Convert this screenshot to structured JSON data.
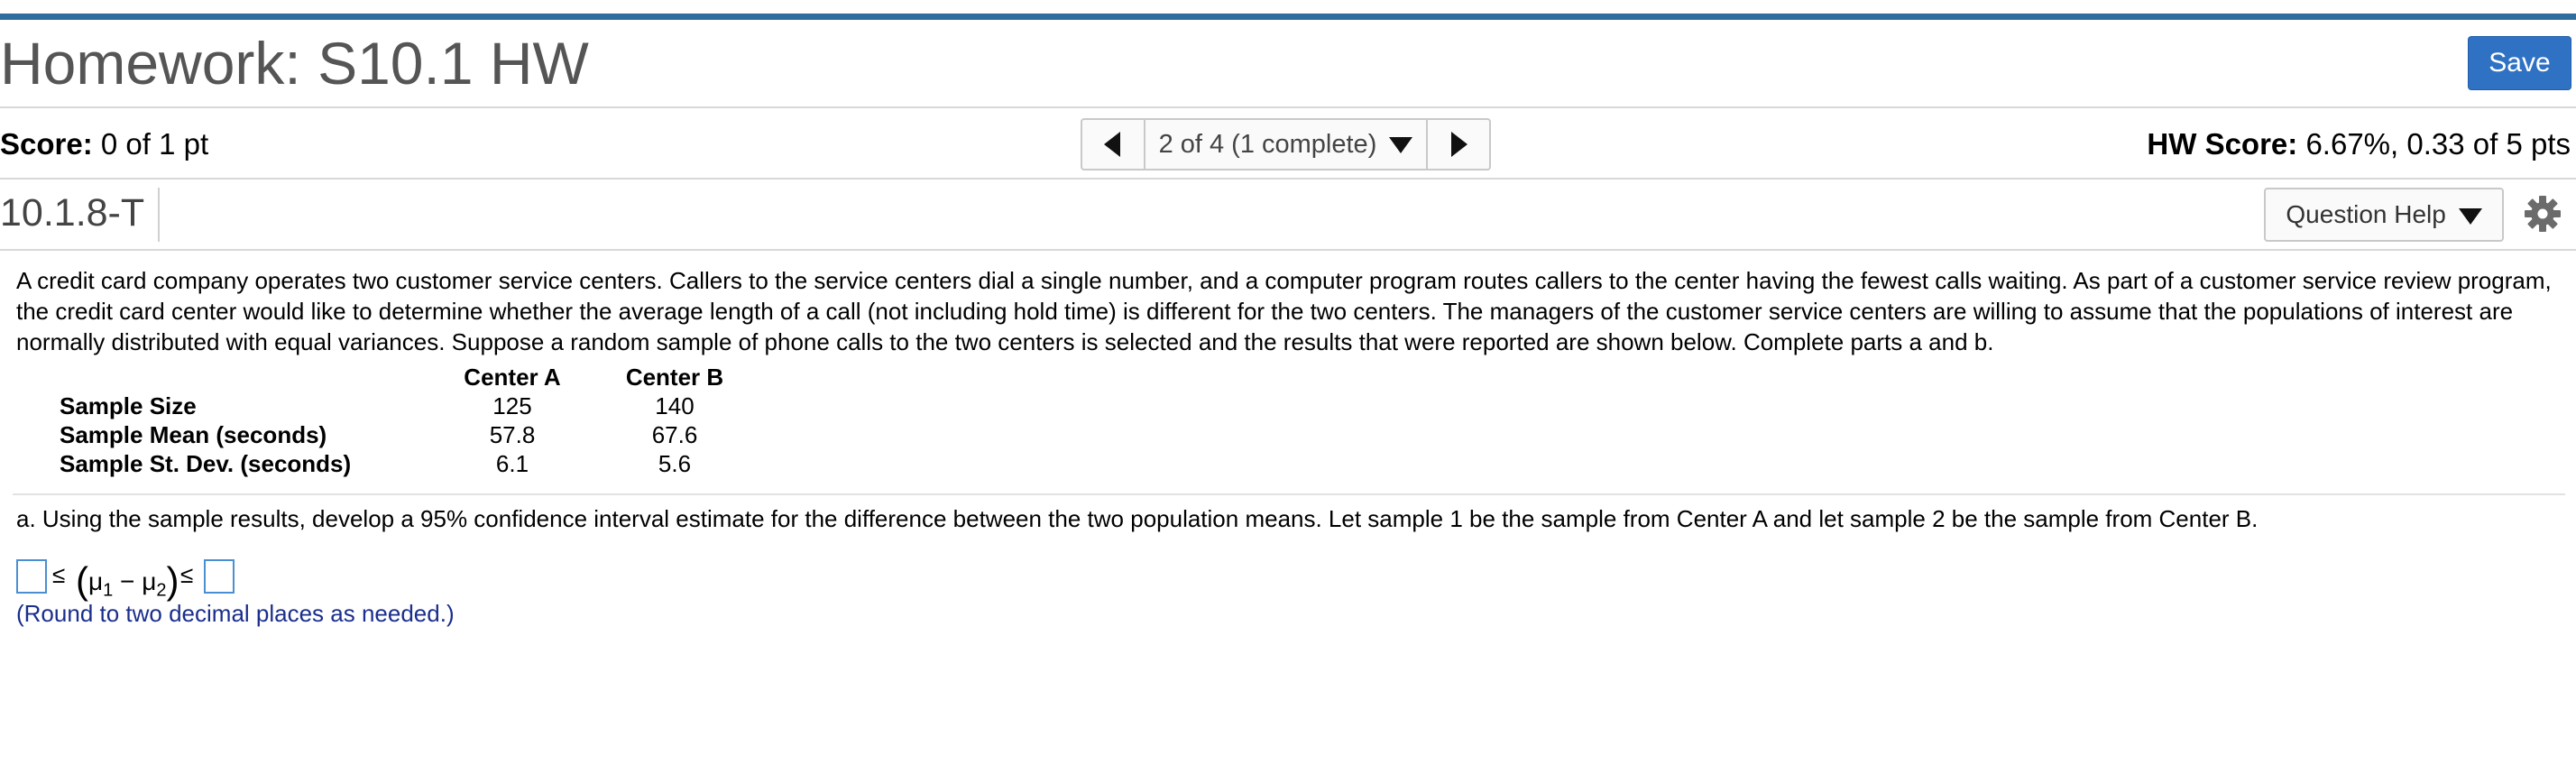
{
  "header": {
    "title": "Homework: S10.1 HW",
    "save_label": "Save"
  },
  "score_bar": {
    "score_label": "Score:",
    "score_value": "0 of 1 pt",
    "nav_text": "2 of 4 (1 complete)",
    "hw_label": "HW Score:",
    "hw_value": "6.67%, 0.33 of 5 pts"
  },
  "question_bar": {
    "question_id": "10.1.8-T",
    "help_label": "Question Help"
  },
  "question": {
    "text": "A credit card company operates two customer service centers. Callers to the service centers dial a single number, and a computer program routes callers to the center having the fewest calls waiting. As part of a customer service review program, the credit card center would like to determine whether the average length of a call (not including hold time) is different for the two centers. The managers of the customer service centers are willing to assume that the populations of interest are normally distributed with equal variances. Suppose a random sample of phone calls to the two centers is selected and the results that were reported are shown below. Complete parts a and b.",
    "table": {
      "headers": [
        "",
        "Center A",
        "Center B"
      ],
      "rows": [
        [
          "Sample Size",
          "125",
          "140"
        ],
        [
          "Sample Mean (seconds)",
          "57.8",
          "67.6"
        ],
        [
          "Sample St. Dev. (seconds)",
          "6.1",
          "5.6"
        ]
      ]
    },
    "part_a": "a. Using the sample results, develop a 95% confidence interval estimate for the difference between the two population means. Let sample 1 be the sample from Center A and let sample 2 be the sample from Center B.",
    "ci": {
      "le": "≤",
      "mu": "μ",
      "sub1": "1",
      "minus": "−",
      "sub2": "2",
      "lower_value": "",
      "upper_value": ""
    },
    "round_note": "(Round to two decimal places as needed.)"
  },
  "colors": {
    "top_bar": "#2e6e9e",
    "save_button": "#2f72c4",
    "input_border": "#4b8fd3",
    "round_note": "#1a2e8c"
  },
  "icons": [
    "prev-arrow-icon",
    "next-arrow-icon",
    "dropdown-triangle-icon",
    "gear-icon"
  ]
}
